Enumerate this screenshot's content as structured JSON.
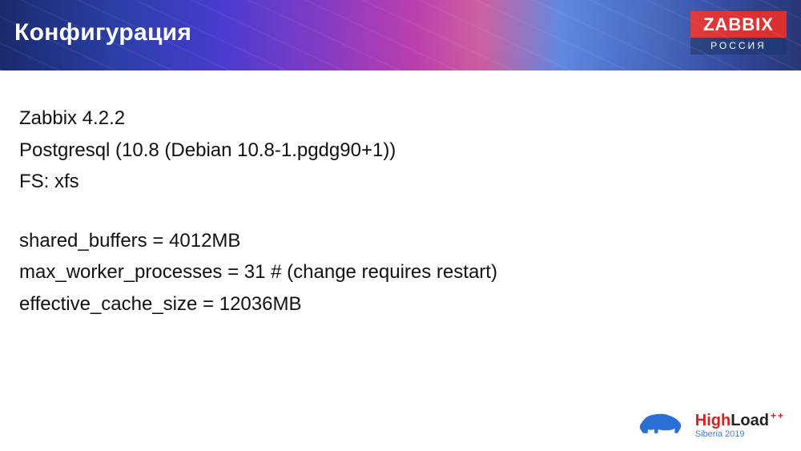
{
  "header": {
    "title": "Конфигурация",
    "logo_main": "ZABBIX",
    "logo_sub": "РОССИЯ"
  },
  "config": {
    "env": [
      "Zabbix 4.2.2",
      "Postgresql (10.8 (Debian 10.8-1.pgdg90+1))",
      "FS: xfs"
    ],
    "params": [
      "shared_buffers = 4012MB",
      "max_worker_processes = 31                  # (change requires restart)",
      "effective_cache_size = 12036MB"
    ]
  },
  "footer": {
    "highload_high": "High",
    "highload_load": "Load",
    "highload_plus": "++",
    "highload_sub": "Siberia 2019"
  }
}
